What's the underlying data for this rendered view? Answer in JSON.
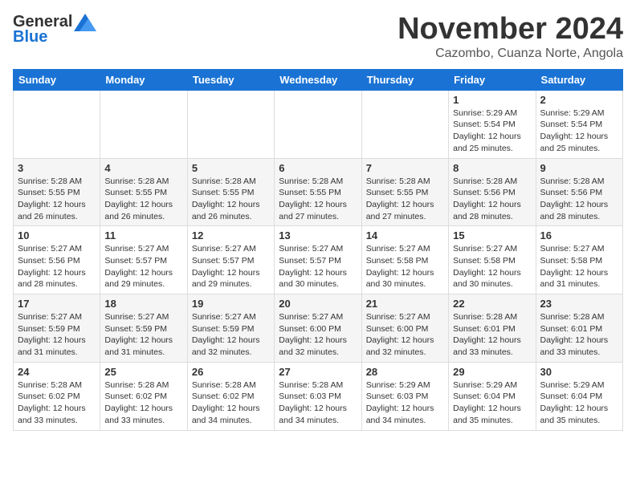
{
  "logo": {
    "general": "General",
    "blue": "Blue"
  },
  "header": {
    "month": "November 2024",
    "location": "Cazombo, Cuanza Norte, Angola"
  },
  "weekdays": [
    "Sunday",
    "Monday",
    "Tuesday",
    "Wednesday",
    "Thursday",
    "Friday",
    "Saturday"
  ],
  "weeks": [
    [
      {
        "day": "",
        "info": ""
      },
      {
        "day": "",
        "info": ""
      },
      {
        "day": "",
        "info": ""
      },
      {
        "day": "",
        "info": ""
      },
      {
        "day": "",
        "info": ""
      },
      {
        "day": "1",
        "info": "Sunrise: 5:29 AM\nSunset: 5:54 PM\nDaylight: 12 hours\nand 25 minutes."
      },
      {
        "day": "2",
        "info": "Sunrise: 5:29 AM\nSunset: 5:54 PM\nDaylight: 12 hours\nand 25 minutes."
      }
    ],
    [
      {
        "day": "3",
        "info": "Sunrise: 5:28 AM\nSunset: 5:55 PM\nDaylight: 12 hours\nand 26 minutes."
      },
      {
        "day": "4",
        "info": "Sunrise: 5:28 AM\nSunset: 5:55 PM\nDaylight: 12 hours\nand 26 minutes."
      },
      {
        "day": "5",
        "info": "Sunrise: 5:28 AM\nSunset: 5:55 PM\nDaylight: 12 hours\nand 26 minutes."
      },
      {
        "day": "6",
        "info": "Sunrise: 5:28 AM\nSunset: 5:55 PM\nDaylight: 12 hours\nand 27 minutes."
      },
      {
        "day": "7",
        "info": "Sunrise: 5:28 AM\nSunset: 5:55 PM\nDaylight: 12 hours\nand 27 minutes."
      },
      {
        "day": "8",
        "info": "Sunrise: 5:28 AM\nSunset: 5:56 PM\nDaylight: 12 hours\nand 28 minutes."
      },
      {
        "day": "9",
        "info": "Sunrise: 5:28 AM\nSunset: 5:56 PM\nDaylight: 12 hours\nand 28 minutes."
      }
    ],
    [
      {
        "day": "10",
        "info": "Sunrise: 5:27 AM\nSunset: 5:56 PM\nDaylight: 12 hours\nand 28 minutes."
      },
      {
        "day": "11",
        "info": "Sunrise: 5:27 AM\nSunset: 5:57 PM\nDaylight: 12 hours\nand 29 minutes."
      },
      {
        "day": "12",
        "info": "Sunrise: 5:27 AM\nSunset: 5:57 PM\nDaylight: 12 hours\nand 29 minutes."
      },
      {
        "day": "13",
        "info": "Sunrise: 5:27 AM\nSunset: 5:57 PM\nDaylight: 12 hours\nand 30 minutes."
      },
      {
        "day": "14",
        "info": "Sunrise: 5:27 AM\nSunset: 5:58 PM\nDaylight: 12 hours\nand 30 minutes."
      },
      {
        "day": "15",
        "info": "Sunrise: 5:27 AM\nSunset: 5:58 PM\nDaylight: 12 hours\nand 30 minutes."
      },
      {
        "day": "16",
        "info": "Sunrise: 5:27 AM\nSunset: 5:58 PM\nDaylight: 12 hours\nand 31 minutes."
      }
    ],
    [
      {
        "day": "17",
        "info": "Sunrise: 5:27 AM\nSunset: 5:59 PM\nDaylight: 12 hours\nand 31 minutes."
      },
      {
        "day": "18",
        "info": "Sunrise: 5:27 AM\nSunset: 5:59 PM\nDaylight: 12 hours\nand 31 minutes."
      },
      {
        "day": "19",
        "info": "Sunrise: 5:27 AM\nSunset: 5:59 PM\nDaylight: 12 hours\nand 32 minutes."
      },
      {
        "day": "20",
        "info": "Sunrise: 5:27 AM\nSunset: 6:00 PM\nDaylight: 12 hours\nand 32 minutes."
      },
      {
        "day": "21",
        "info": "Sunrise: 5:27 AM\nSunset: 6:00 PM\nDaylight: 12 hours\nand 32 minutes."
      },
      {
        "day": "22",
        "info": "Sunrise: 5:28 AM\nSunset: 6:01 PM\nDaylight: 12 hours\nand 33 minutes."
      },
      {
        "day": "23",
        "info": "Sunrise: 5:28 AM\nSunset: 6:01 PM\nDaylight: 12 hours\nand 33 minutes."
      }
    ],
    [
      {
        "day": "24",
        "info": "Sunrise: 5:28 AM\nSunset: 6:02 PM\nDaylight: 12 hours\nand 33 minutes."
      },
      {
        "day": "25",
        "info": "Sunrise: 5:28 AM\nSunset: 6:02 PM\nDaylight: 12 hours\nand 33 minutes."
      },
      {
        "day": "26",
        "info": "Sunrise: 5:28 AM\nSunset: 6:02 PM\nDaylight: 12 hours\nand 34 minutes."
      },
      {
        "day": "27",
        "info": "Sunrise: 5:28 AM\nSunset: 6:03 PM\nDaylight: 12 hours\nand 34 minutes."
      },
      {
        "day": "28",
        "info": "Sunrise: 5:29 AM\nSunset: 6:03 PM\nDaylight: 12 hours\nand 34 minutes."
      },
      {
        "day": "29",
        "info": "Sunrise: 5:29 AM\nSunset: 6:04 PM\nDaylight: 12 hours\nand 35 minutes."
      },
      {
        "day": "30",
        "info": "Sunrise: 5:29 AM\nSunset: 6:04 PM\nDaylight: 12 hours\nand 35 minutes."
      }
    ]
  ]
}
